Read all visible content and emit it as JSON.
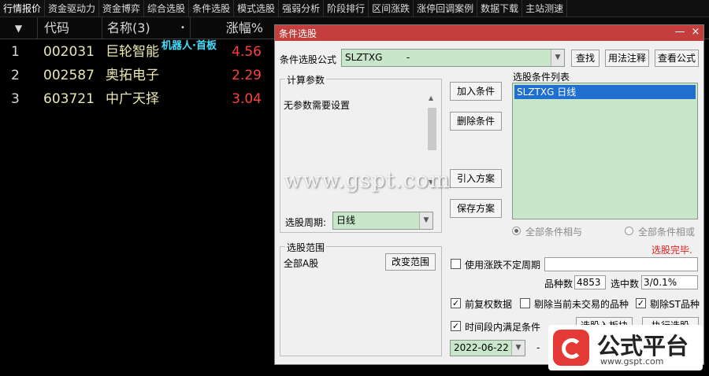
{
  "menubar": [
    "行情报价",
    "资金驱动力",
    "资金博弈",
    "综合选股",
    "条件选股",
    "模式选股",
    "强弱分析",
    "阶段排行",
    "区间涨跌",
    "涨停回调案例",
    "数据下载",
    "主站测速"
  ],
  "table": {
    "headers": {
      "arrow": "▼",
      "code": "代码",
      "name": "名称(3)",
      "dot": "•",
      "pct": "涨幅%"
    },
    "rows": [
      {
        "idx": "1",
        "code": "002031",
        "name": "巨轮智能",
        "pct": "4.56"
      },
      {
        "idx": "2",
        "code": "002587",
        "name": "奥拓电子",
        "pct": "2.29"
      },
      {
        "idx": "3",
        "code": "603721",
        "name": "中广天择",
        "pct": "3.04"
      }
    ],
    "robot_tag": "机器人·首板"
  },
  "dialog": {
    "title": "条件选股",
    "min_btn": "—",
    "close_btn": "×",
    "formula_label": "条件选股公式",
    "formula_value": "SLZTXG        -",
    "btn_query": "查找",
    "btn_usage": "用法注释",
    "btn_view": "查看公式",
    "params_title": "计算参数",
    "params_text": "无参数需要设置",
    "period_label": "选股周期:",
    "period_value": "日线",
    "btn_add": "加入条件",
    "btn_delete": "删除条件",
    "btn_import": "引入方案",
    "btn_save": "保存方案",
    "list_title": "选股条件列表",
    "list_items": [
      "SLZTXG  日线"
    ],
    "radio_and": "全部条件相与",
    "radio_or": "全部条件相或",
    "status": "选股完毕.",
    "scope_title": "选股范围",
    "scope_value": "全部A股",
    "btn_change_scope": "改变范围",
    "chk_irregular": "使用涨跌不定周期",
    "count_label": "品种数",
    "count_value": "4853",
    "selected_label": "选中数",
    "selected_value": "3/0.1%",
    "chk_adjust": "前复权数据",
    "chk_exclude_untraded": "剔除当前未交易的品种",
    "chk_exclude_st": "剔除ST品种",
    "chk_period": "时间段内满足条件",
    "date_start": "2022-06-22",
    "date_dash": "-",
    "btn_to_block": "选股入板块",
    "btn_execute": "执行选股"
  },
  "watermark": "www.gspt.com",
  "logo": {
    "text": "公式平台",
    "url": "www.gspt.com"
  }
}
